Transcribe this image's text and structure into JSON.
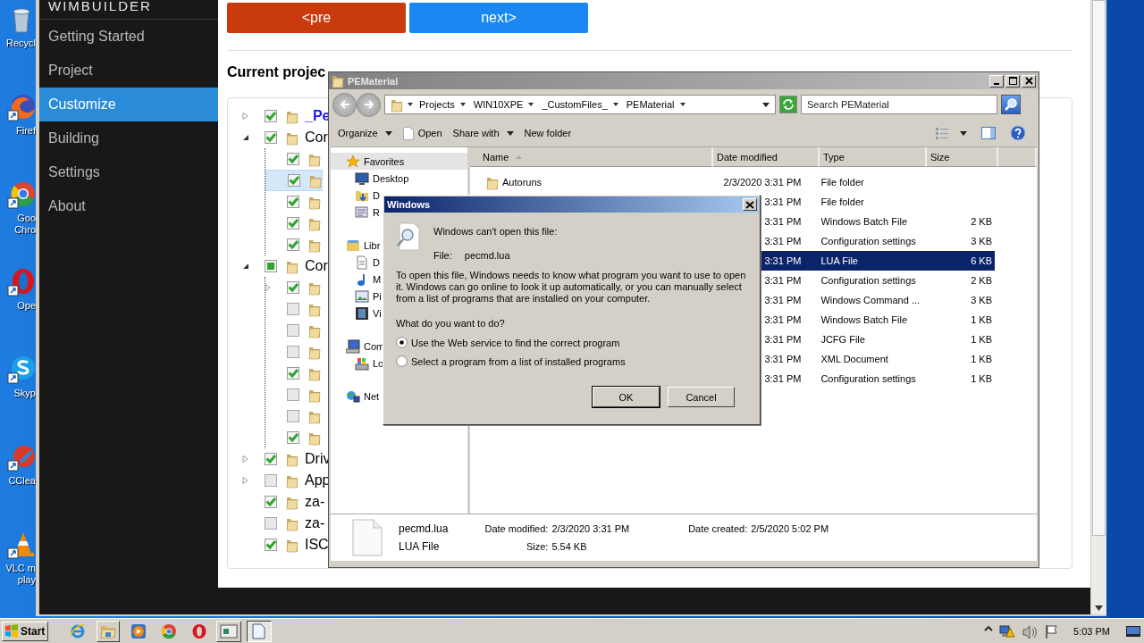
{
  "desktop_icons": [
    {
      "kind": "trash",
      "label": "Recycl"
    },
    {
      "kind": "firefox",
      "label": "Firef"
    },
    {
      "kind": "chrome",
      "label": "Goo Chro"
    },
    {
      "kind": "opera",
      "label": "Ope"
    },
    {
      "kind": "skype",
      "label": "Skyp"
    },
    {
      "kind": "ccleaner",
      "label": "CClea"
    },
    {
      "kind": "vlc",
      "label": "VLC m play"
    }
  ],
  "app": {
    "brand": "WIMBUILDER",
    "nav": [
      {
        "label": "Getting Started",
        "selected": false
      },
      {
        "label": "Project",
        "selected": false
      },
      {
        "label": "Customize",
        "selected": true
      },
      {
        "label": "Building",
        "selected": false
      },
      {
        "label": "Settings",
        "selected": false
      },
      {
        "label": "About",
        "selected": false
      }
    ],
    "buttons": [
      {
        "label": "<pre",
        "kind": "prev"
      },
      {
        "label": "next>",
        "kind": "next"
      }
    ],
    "project_label": "Current projec",
    "tree": [
      {
        "label": "_Pe",
        "kind": "project",
        "checked": true,
        "partial": false,
        "expanded": false,
        "selected": false
      },
      {
        "label": "Cor",
        "kind": "folder",
        "checked": true,
        "partial": false,
        "expanded": true,
        "selected": false,
        "children": [
          {
            "kind": "folder",
            "checked": true,
            "selected": false
          },
          {
            "kind": "folder",
            "checked": true,
            "selected": true
          },
          {
            "kind": "folder",
            "checked": true,
            "selected": false
          },
          {
            "kind": "folder",
            "checked": true,
            "selected": false
          },
          {
            "kind": "folder",
            "checked": true,
            "selected": false
          }
        ]
      },
      {
        "label": "Cor",
        "kind": "folder",
        "checked": false,
        "partial": true,
        "expanded": true,
        "selected": false,
        "children": [
          {
            "kind": "folder",
            "checked": true,
            "expanded": false,
            "selected": false
          },
          {
            "kind": "folder",
            "checked": false,
            "selected": false
          },
          {
            "kind": "folder",
            "checked": false,
            "selected": false
          },
          {
            "kind": "folder",
            "checked": false,
            "selected": false
          },
          {
            "kind": "folder",
            "checked": true,
            "selected": false
          },
          {
            "kind": "folder",
            "checked": false,
            "selected": false
          },
          {
            "kind": "folder",
            "checked": false,
            "selected": false
          },
          {
            "kind": "folder",
            "checked": true,
            "selected": false
          }
        ]
      },
      {
        "label": "Driv",
        "kind": "folder",
        "checked": true,
        "partial": false,
        "expanded": false,
        "selected": false
      },
      {
        "label": "App",
        "kind": "folder",
        "checked": false,
        "partial": false,
        "expanded": false,
        "selected": false
      },
      {
        "label": "za-",
        "kind": "folder",
        "checked": true,
        "partial": false,
        "selected": false
      },
      {
        "label": "za-",
        "kind": "folder",
        "checked": false,
        "partial": false,
        "selected": false
      },
      {
        "label": "ISC",
        "kind": "folder",
        "checked": true,
        "partial": false,
        "selected": false
      }
    ]
  },
  "explorer": {
    "title": "PEMaterial",
    "breadcrumbs": [
      "Projects",
      "WIN10XPE",
      "_CustomFiles_",
      "PEMaterial"
    ],
    "search": {
      "placeholder": "Search PEMaterial"
    },
    "toolbar": [
      {
        "label": "Organize",
        "kind": "menu"
      },
      {
        "label": "Open",
        "kind": "open"
      },
      {
        "label": "Share with",
        "kind": "menu"
      },
      {
        "label": "New folder",
        "kind": "plain"
      }
    ],
    "nav": [
      {
        "label": "Favorites",
        "kind": "star",
        "children": [
          {
            "label": "Desktop",
            "kind": "desktop"
          },
          {
            "label": "D",
            "kind": "downloads"
          },
          {
            "label": "R",
            "kind": "recent"
          }
        ]
      },
      {
        "label": "Libr",
        "kind": "library",
        "children": [
          {
            "label": "D",
            "kind": "document"
          },
          {
            "label": "M",
            "kind": "music"
          },
          {
            "label": "Pi",
            "kind": "pictures"
          },
          {
            "label": "Vi",
            "kind": "videos"
          }
        ]
      },
      {
        "label": "Com",
        "kind": "computer",
        "children": [
          {
            "label": "Lo",
            "kind": "drive"
          }
        ]
      },
      {
        "label": "Net",
        "kind": "network"
      }
    ],
    "columns": [
      "Name",
      "Date modified",
      "Type",
      "Size"
    ],
    "files": [
      {
        "name": "Autoruns",
        "date": "2/3/2020 3:31 PM",
        "type": "File folder",
        "selected": false
      },
      {
        "date": "3:31 PM",
        "type": "File folder",
        "selected": false
      },
      {
        "date": "3:31 PM",
        "type": "Windows Batch File",
        "size": "2 KB",
        "selected": false
      },
      {
        "date": "3:31 PM",
        "type": "Configuration settings",
        "size": "3 KB",
        "selected": false
      },
      {
        "date": "3:31 PM",
        "type": "LUA File",
        "size": "6 KB",
        "selected": true
      },
      {
        "date": "3:31 PM",
        "type": "Configuration settings",
        "size": "2 KB",
        "selected": false
      },
      {
        "date": "3:31 PM",
        "type": "Windows Command ...",
        "size": "3 KB",
        "selected": false
      },
      {
        "date": "3:31 PM",
        "type": "Windows Batch File",
        "size": "1 KB",
        "selected": false
      },
      {
        "date": "3:31 PM",
        "type": "JCFG File",
        "size": "1 KB",
        "selected": false
      },
      {
        "date": "3:31 PM",
        "type": "XML Document",
        "size": "1 KB",
        "selected": false
      },
      {
        "date": "3:31 PM",
        "type": "Configuration settings",
        "size": "1 KB",
        "selected": false
      }
    ],
    "details": {
      "name": "pecmd.lua",
      "type": "LUA File",
      "modified": {
        "label": "Date modified:",
        "value": "2/3/2020 3:31 PM"
      },
      "size": {
        "label": "Size:",
        "value": "5.54 KB"
      },
      "created": {
        "label": "Date created:",
        "value": "2/5/2020 5:02 PM"
      }
    }
  },
  "dialog": {
    "title": "Windows",
    "heading": "Windows can't open this file:",
    "file_label": "File:",
    "file_name": "pecmd.lua",
    "message": "To open this file, Windows needs to know what program you want to use to open it. Windows can go online to look it up automatically, or you can manually select from a list of programs that are installed on your computer.",
    "question": "What do you want to do?",
    "options": [
      {
        "label": "Use the Web service to find the correct program",
        "selected": true
      },
      {
        "label": "Select a program from a list of installed programs",
        "selected": false
      }
    ],
    "buttons": [
      {
        "label": "OK",
        "kind": "default"
      },
      {
        "label": "Cancel",
        "kind": "normal"
      }
    ]
  },
  "taskbar": {
    "start": "Start",
    "quick_launch": [
      {
        "kind": "ie"
      },
      {
        "kind": "explorer"
      },
      {
        "kind": "media"
      },
      {
        "kind": "chrome"
      },
      {
        "kind": "opera"
      }
    ],
    "tasks": [
      {
        "kind": "window",
        "selected": false
      },
      {
        "kind": "document",
        "selected": true
      }
    ],
    "tray": [
      {
        "kind": "chevron"
      },
      {
        "kind": "network"
      },
      {
        "kind": "volume"
      },
      {
        "kind": "flag"
      }
    ],
    "time": "5:03 PM"
  }
}
